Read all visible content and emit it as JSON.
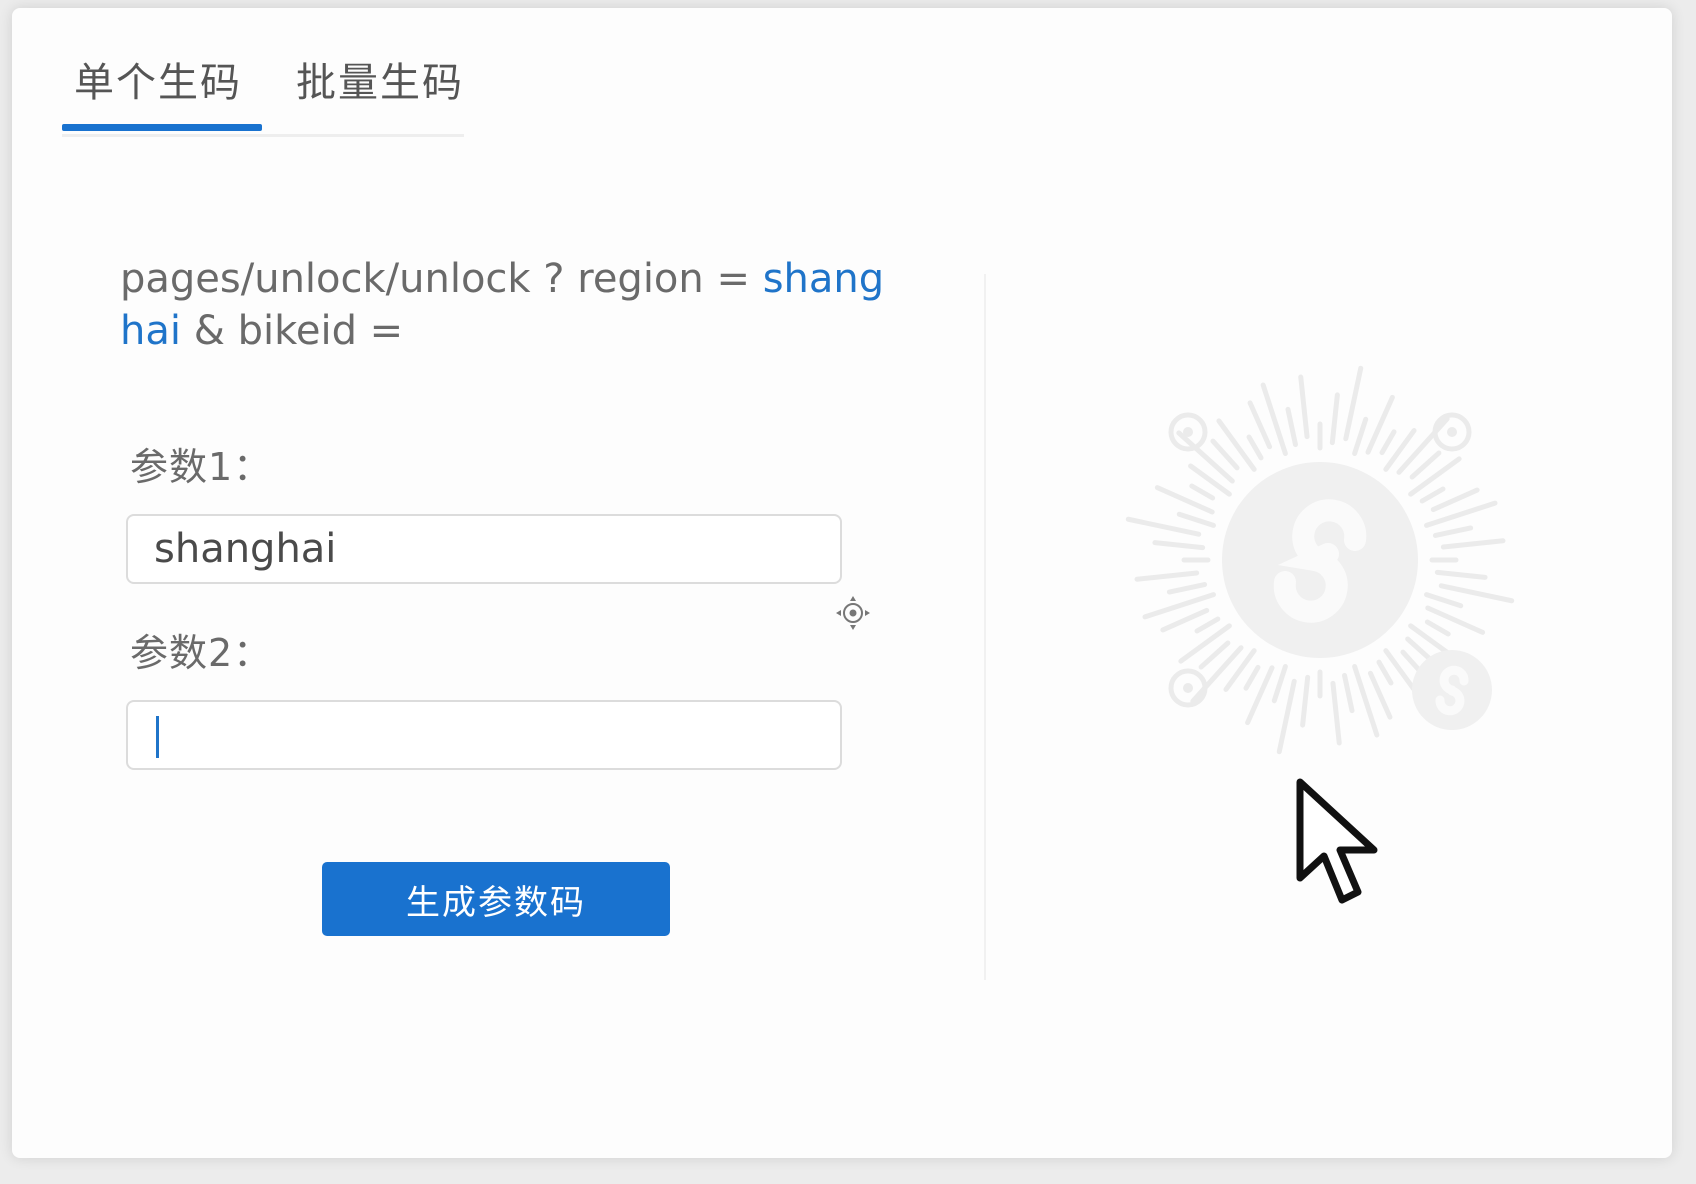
{
  "tabs": [
    {
      "label": "单个生码",
      "active": true
    },
    {
      "label": "批量生码",
      "active": false
    }
  ],
  "url": {
    "prefix": "pages/unlock/unlock ? region = ",
    "param1_value": "shanghai",
    "suffix": " & bikeid ="
  },
  "form": {
    "param1_label": "参数1：",
    "param1_value": "shanghai",
    "param2_label": "参数2：",
    "param2_value": ""
  },
  "generate_button": "生成参数码",
  "icons": {
    "qr_placeholder": "mini-program-code-placeholder-icon",
    "move_cursor": "move-cursor-icon",
    "mouse_pointer": "mouse-pointer-icon"
  },
  "colors": {
    "accent": "#1972cf",
    "text": "#6a6a6a"
  }
}
